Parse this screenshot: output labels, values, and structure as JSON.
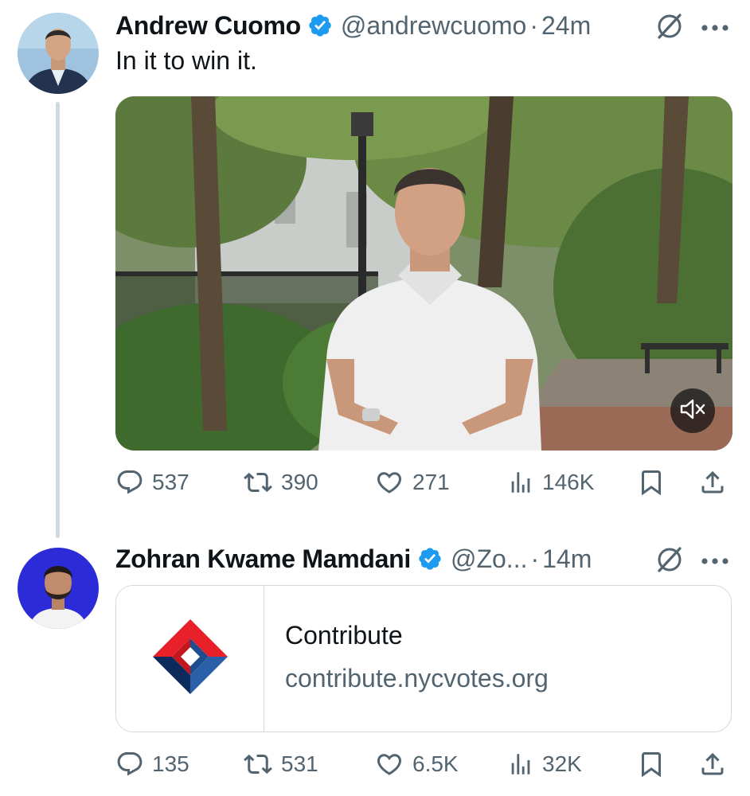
{
  "tweets": [
    {
      "author_name": "Andrew Cuomo",
      "handle": "@andrewcuomo",
      "separator": "·",
      "time": "24m",
      "text": "In it to win it.",
      "media": {
        "type": "video",
        "muted": true,
        "mute_icon": "speaker-muted-icon"
      },
      "counts": {
        "replies": "537",
        "reposts": "390",
        "likes": "271",
        "views": "146K"
      }
    },
    {
      "author_name": "Zohran Kwame Mamdani",
      "handle": "@Zo...",
      "separator": "·",
      "time": "14m",
      "card": {
        "title": "Contribute",
        "domain": "contribute.nycvotes.org"
      },
      "counts": {
        "replies": "135",
        "reposts": "531",
        "likes": "6.5K",
        "views": "32K"
      }
    }
  ],
  "colors": {
    "verified_badge": "#1d9bf0",
    "secondary_text": "#536471",
    "divider": "#cfd9de",
    "logo_red": "#e8202a",
    "logo_blue": "#2b5fa8",
    "logo_navy": "#0d2a5c"
  }
}
